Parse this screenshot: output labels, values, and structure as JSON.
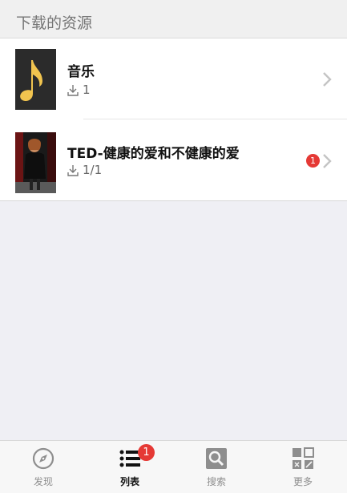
{
  "header": {
    "title": "下载的资源"
  },
  "items": [
    {
      "title": "音乐",
      "count": "1",
      "icon": "music-note-icon",
      "thumb_bg": "#2b2b2b",
      "note_color": "#f1c44f"
    },
    {
      "title": "TED-健康的爱和不健康的爱",
      "count": "1/1",
      "badge": "1",
      "icon": "video-thumbnail"
    }
  ],
  "tabbar": {
    "tabs": [
      {
        "label": "发现",
        "icon": "compass-icon"
      },
      {
        "label": "列表",
        "icon": "list-icon",
        "badge": "1",
        "active": true
      },
      {
        "label": "搜索",
        "icon": "search-icon"
      },
      {
        "label": "更多",
        "icon": "grid-more-icon"
      }
    ]
  },
  "colors": {
    "badge": "#e53935",
    "accent_text": "#111111",
    "inactive": "#8e8e8e"
  }
}
